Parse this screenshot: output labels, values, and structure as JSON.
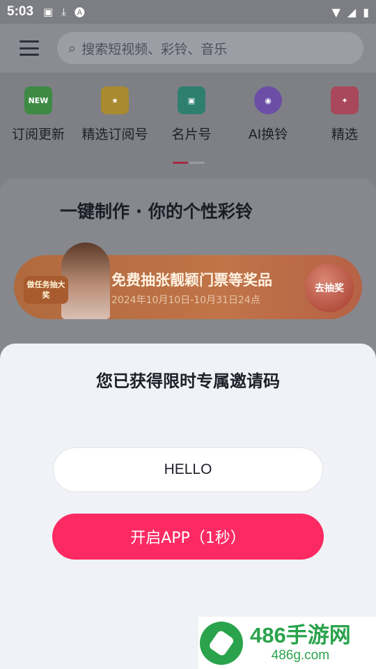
{
  "status_bar": {
    "time": "5:03",
    "left_icons": [
      "image-icon",
      "download-icon",
      "a-icon"
    ],
    "right_icons": [
      "wifi-icon",
      "signal-icon",
      "battery-icon"
    ]
  },
  "header": {
    "search_placeholder": "搜索短视频、彩铃、音乐"
  },
  "quick_nav": [
    {
      "label": "订阅更新",
      "icon": "new-icon",
      "icon_text": "NEW",
      "color": "#3fb24a"
    },
    {
      "label": "精选订阅号",
      "icon": "star-icon",
      "icon_text": "★",
      "color": "#e3b52a"
    },
    {
      "label": "名片号",
      "icon": "id-card-icon",
      "icon_text": "▣",
      "color": "#29a58c"
    },
    {
      "label": "AI换铃",
      "icon": "ai-avatar-icon",
      "icon_text": "◉",
      "color": "#8a5bd8"
    },
    {
      "label": "精选",
      "icon": "gift-icon",
      "icon_text": "✦",
      "color": "#e84a5f"
    }
  ],
  "promo": {
    "title": "一键制作 · 你的个性彩铃",
    "banner_badge": "做任务抽大奖",
    "banner_headline": "免费抽张靓颖门票等奖品",
    "banner_sub": "2024年10月10日-10月31日24点",
    "banner_button": "去抽奖"
  },
  "dialog": {
    "title": "您已获得限时专属邀请码",
    "code": "HELLO",
    "open_button": "开启APP（1秒）"
  },
  "watermark": {
    "big": "486手游网",
    "small": "486g.com"
  },
  "colors": {
    "accent": "#fc2a63",
    "watermark_green": "#2aa34c"
  }
}
